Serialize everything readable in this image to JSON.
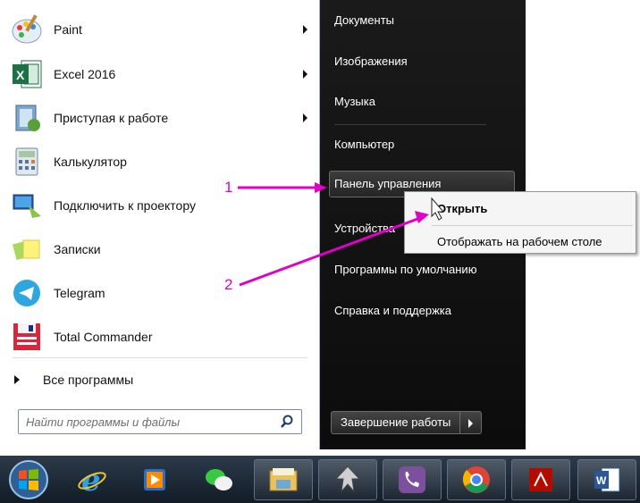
{
  "left_panel": {
    "programs": [
      {
        "label": "Paint",
        "icon": "paint-icon",
        "has_submenu": true
      },
      {
        "label": "Excel 2016",
        "icon": "excel-icon",
        "has_submenu": true
      },
      {
        "label": "Приступая к работе",
        "icon": "getting-started-icon",
        "has_submenu": true
      },
      {
        "label": "Калькулятор",
        "icon": "calculator-icon",
        "has_submenu": false
      },
      {
        "label": "Подключить к проектору",
        "icon": "projector-icon",
        "has_submenu": false
      },
      {
        "label": "Записки",
        "icon": "sticky-notes-icon",
        "has_submenu": false
      },
      {
        "label": "Telegram",
        "icon": "telegram-icon",
        "has_submenu": false
      },
      {
        "label": "Total Commander",
        "icon": "total-commander-icon",
        "has_submenu": false
      }
    ],
    "all_programs": "Все программы",
    "search_placeholder": "Найти программы и файлы"
  },
  "right_panel": {
    "items": [
      "Документы",
      "Изображения",
      "Музыка",
      "Компьютер",
      "Панель управления",
      "Устройства",
      "Программы по умолчанию",
      "Справка и поддержка"
    ],
    "shutdown_label": "Завершение работы"
  },
  "context_menu": {
    "open": "Открыть",
    "show_on_desktop": "Отображать на рабочем столе"
  },
  "annotations": {
    "step1": "1",
    "step2": "2",
    "color": "#e000c8"
  },
  "taskbar": {
    "icons": [
      "start-orb-icon",
      "internet-explorer-icon",
      "media-player-icon",
      "wechat-icon",
      "file-explorer-icon",
      "inkscape-icon",
      "viber-icon",
      "chrome-icon",
      "acrobat-icon",
      "word-icon"
    ]
  }
}
